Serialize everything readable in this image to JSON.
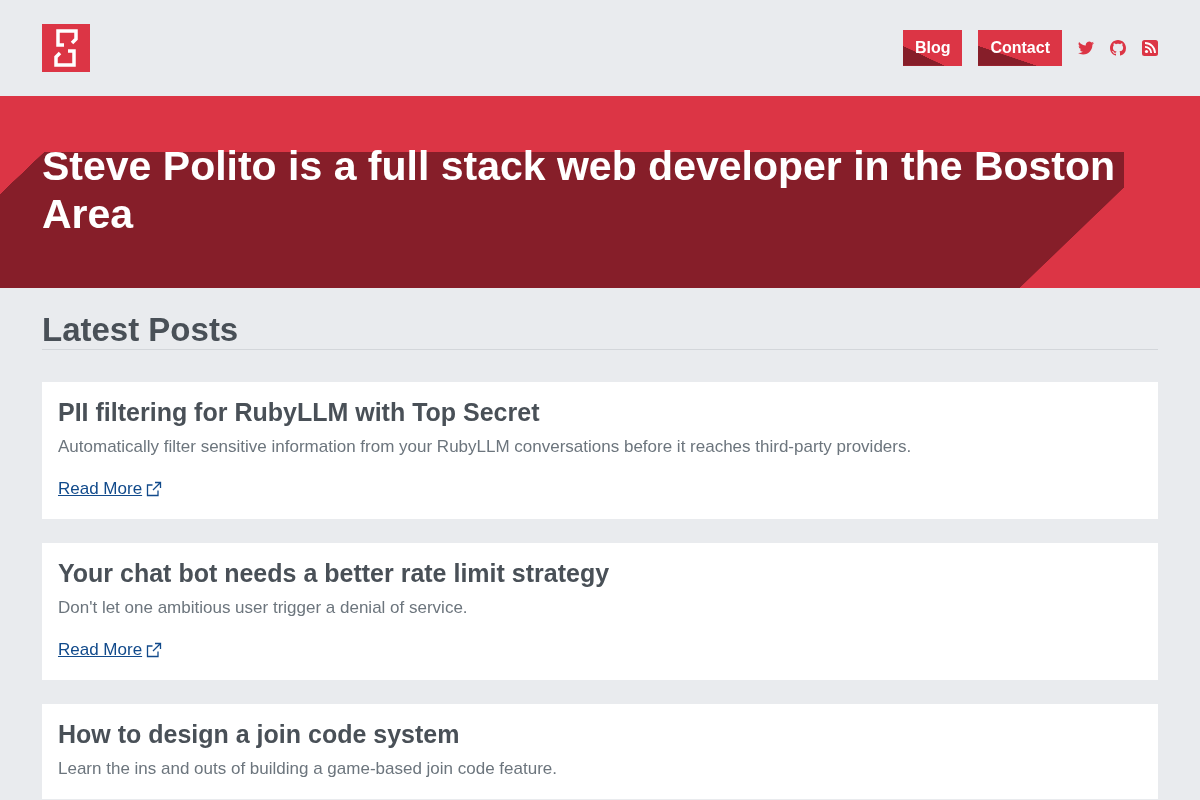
{
  "header": {
    "nav": [
      {
        "label": "Blog"
      },
      {
        "label": "Contact"
      }
    ],
    "social_links": [
      {
        "kind": "twitter"
      },
      {
        "kind": "github"
      },
      {
        "kind": "rss"
      }
    ]
  },
  "hero": {
    "title": "Steve Polito is a full stack web developer in the Boston Area"
  },
  "latest_posts": {
    "heading": "Latest Posts",
    "posts": [
      {
        "title": "PII filtering for RubyLLM with Top Secret",
        "description": "Automatically filter sensitive information from your RubyLLM conversations before it reaches third-party providers.",
        "link": "Read More"
      },
      {
        "title": "Your chat bot needs a better rate limit strategy",
        "description": "Don't let one ambitious user trigger a denial of service.",
        "link": "Read More"
      },
      {
        "title": "How to design a join code system",
        "description": "Learn the ins and outs of building a game-based join code feature."
      }
    ]
  }
}
